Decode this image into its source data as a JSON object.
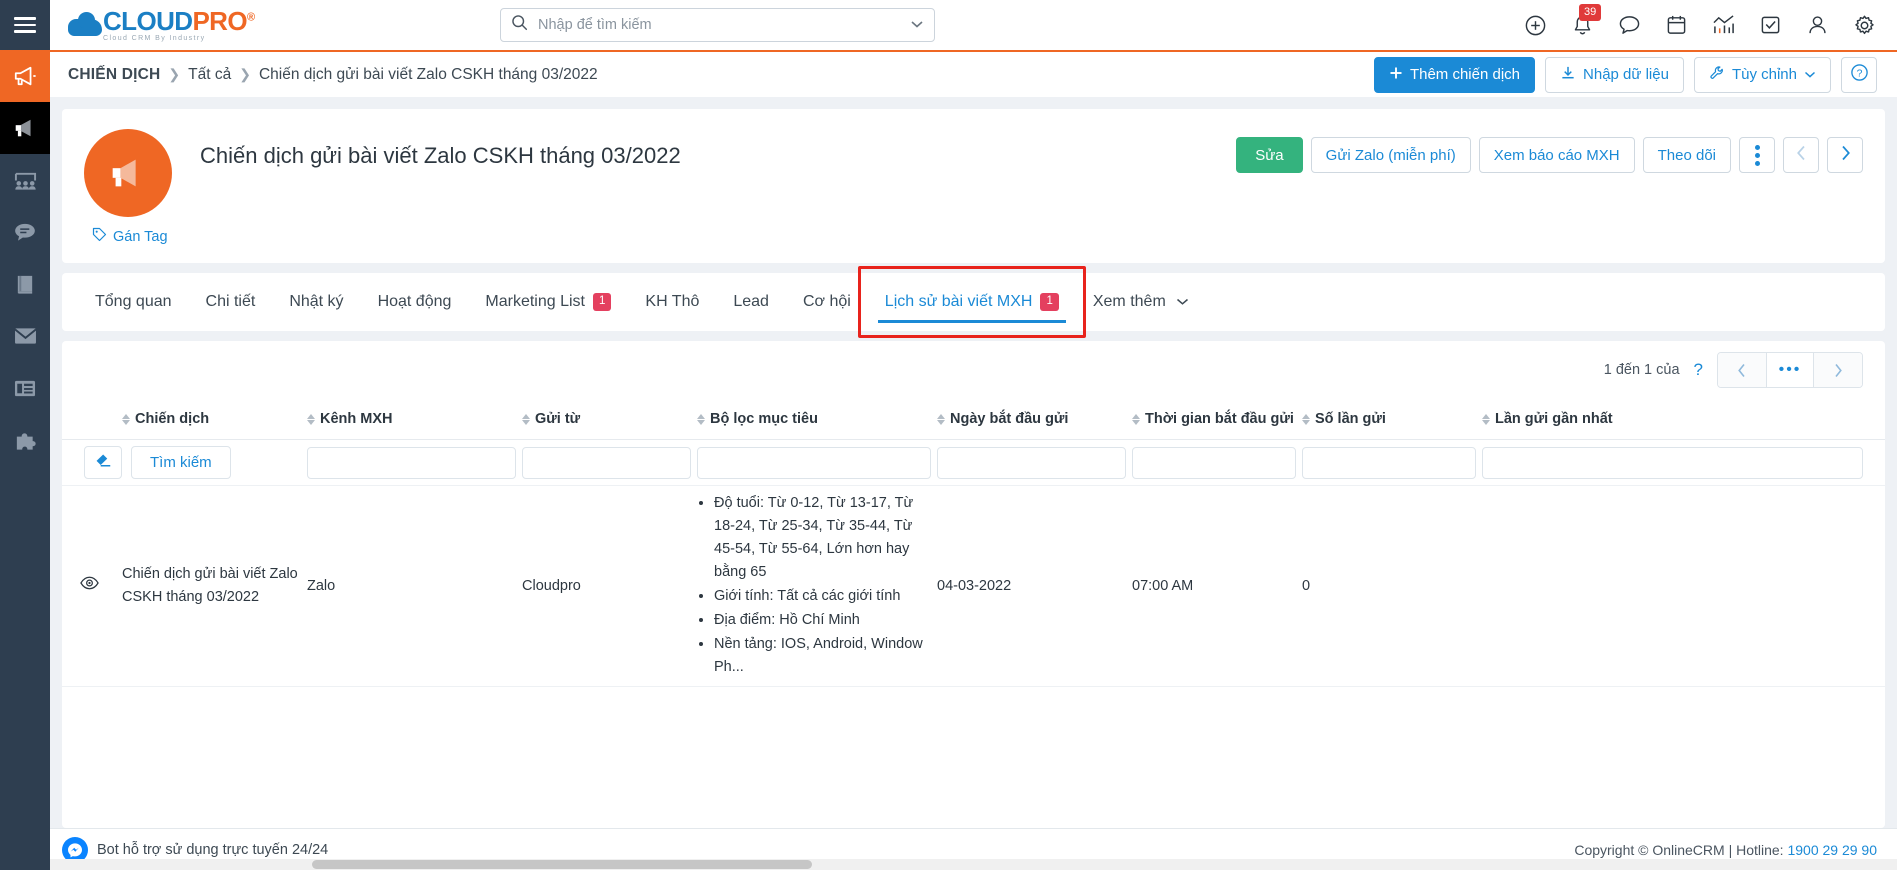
{
  "topbar": {
    "menu_icon": "hamburger-icon",
    "brand": {
      "cloud": "CLOUD",
      "pro": "PRO",
      "reg": "®",
      "tagline": "Cloud CRM By Industry"
    },
    "search": {
      "placeholder": "Nhập để tìm kiếm",
      "value": "",
      "icon": "search-icon",
      "caret": "chevron-down-icon"
    },
    "icons": [
      {
        "name": "add-circle-icon",
        "label": "Thêm"
      },
      {
        "name": "bell-icon",
        "label": "Thông báo",
        "badge": "39"
      },
      {
        "name": "chat-bubble-icon",
        "label": "Tin nhắn"
      },
      {
        "name": "calendar-icon",
        "label": "Lịch"
      },
      {
        "name": "analytics-icon",
        "label": "Báo cáo"
      },
      {
        "name": "checkbox-task-icon",
        "label": "Công việc"
      },
      {
        "name": "user-icon",
        "label": "Tài khoản"
      },
      {
        "name": "gear-icon",
        "label": "Cài đặt"
      }
    ]
  },
  "sidebar": {
    "items": [
      {
        "name": "sidebar-item-campaign",
        "icon": "megaphone-icon",
        "state": "active"
      },
      {
        "name": "sidebar-item-campaign-sub",
        "icon": "megaphone-filled-icon",
        "state": "dark"
      },
      {
        "name": "sidebar-item-customers",
        "icon": "people-group-icon",
        "state": "normal"
      },
      {
        "name": "sidebar-item-chat",
        "icon": "speech-bubble-icon",
        "state": "normal"
      },
      {
        "name": "sidebar-item-book",
        "icon": "book-icon",
        "state": "normal"
      },
      {
        "name": "sidebar-item-mail",
        "icon": "envelope-icon",
        "state": "normal"
      },
      {
        "name": "sidebar-item-news",
        "icon": "news-icon",
        "state": "normal"
      },
      {
        "name": "sidebar-item-plugin",
        "icon": "puzzle-icon",
        "state": "normal"
      }
    ]
  },
  "breadcrumb": {
    "root": "CHIẾN DỊCH",
    "sep": "❯",
    "level2": "Tất cả",
    "current": "Chiến dịch gửi bài viết Zalo CSKH tháng 03/2022"
  },
  "crumb_actions": {
    "add_campaign": "Thêm chiến dịch",
    "add_icon": "plus-icon",
    "import": "Nhập dữ liệu",
    "import_icon": "import-download-icon",
    "customize": "Tùy chỉnh",
    "customize_icon": "wrench-icon",
    "customize_caret": "chevron-down-icon",
    "help_icon": "question-circle-icon"
  },
  "record": {
    "avatar_icon": "megaphone-icon",
    "title": "Chiến dịch gửi bài viết Zalo CSKH tháng 03/2022",
    "tag_link": "Gán Tag",
    "tag_icon": "tag-icon",
    "actions": [
      {
        "name": "edit-button",
        "label": "Sửa",
        "style": "green"
      },
      {
        "name": "send-zalo-button",
        "label": "Gửi Zalo (miễn phí)",
        "style": "ghost"
      },
      {
        "name": "view-social-report-button",
        "label": "Xem báo cáo MXH",
        "style": "ghost"
      },
      {
        "name": "follow-button",
        "label": "Theo dõi",
        "style": "ghost"
      }
    ],
    "more_icon": "vertical-dots-icon",
    "prev_icon": "chevron-left-icon",
    "next_icon": "chevron-right-icon"
  },
  "tabs": [
    {
      "name": "tab-tong-quan",
      "label": "Tổng quan",
      "count": null,
      "active": false
    },
    {
      "name": "tab-chi-tiet",
      "label": "Chi tiết",
      "count": null,
      "active": false
    },
    {
      "name": "tab-nhat-ky",
      "label": "Nhật ký",
      "count": null,
      "active": false
    },
    {
      "name": "tab-hoat-dong",
      "label": "Hoạt động",
      "count": null,
      "active": false
    },
    {
      "name": "tab-marketing-list",
      "label": "Marketing List",
      "count": "1",
      "active": false
    },
    {
      "name": "tab-kh-tho",
      "label": "KH Thô",
      "count": null,
      "active": false
    },
    {
      "name": "tab-lead",
      "label": "Lead",
      "count": null,
      "active": false
    },
    {
      "name": "tab-co-hoi",
      "label": "Cơ hội",
      "count": null,
      "active": false
    },
    {
      "name": "tab-lich-su-bai-viet-mxh",
      "label": "Lịch sử bài viết MXH",
      "count": "1",
      "active": true
    },
    {
      "name": "tab-xem-them",
      "label": "Xem thêm",
      "count": null,
      "active": false,
      "caret": "chevron-down-icon"
    }
  ],
  "grid": {
    "pager": {
      "label": "1 đến 1 của",
      "unknown": "?",
      "prev_icon": "chevron-left-icon",
      "mid": "•••",
      "next_icon": "chevron-right-icon"
    },
    "search_row": {
      "clear_icon": "eraser-icon",
      "search_button": "Tìm kiếm",
      "inputs": [
        "",
        "",
        "",
        "",
        "",
        "",
        ""
      ]
    },
    "columns": [
      {
        "name": "col-view",
        "label": "",
        "sortable": false
      },
      {
        "name": "col-chien-dich",
        "label": "Chiến dịch",
        "sortable": true
      },
      {
        "name": "col-kenh-mxh",
        "label": "Kênh MXH",
        "sortable": true
      },
      {
        "name": "col-gui-tu",
        "label": "Gửi từ",
        "sortable": true
      },
      {
        "name": "col-bo-loc-muc-tieu",
        "label": "Bộ lọc mục tiêu",
        "sortable": true
      },
      {
        "name": "col-ngay-bat-dau-gui",
        "label": "Ngày bắt đầu gửi",
        "sortable": true
      },
      {
        "name": "col-thoi-gian-bat-dau-gui",
        "label": "Thời gian bắt đầu gửi",
        "sortable": true
      },
      {
        "name": "col-so-lan-gui",
        "label": "Số lần gửi",
        "sortable": true
      },
      {
        "name": "col-lan-gui-gan-nhat",
        "label": "Lần gửi gần nhất",
        "sortable": true
      }
    ],
    "rows": [
      {
        "view_icon": "eye-icon",
        "chien_dich": "Chiến dịch gửi bài viết Zalo CSKH tháng 03/2022",
        "kenh_mxh": "Zalo",
        "gui_tu": "Cloudpro",
        "bo_loc_muc_tieu": [
          "Độ tuổi: Từ 0-12, Từ 13-17, Từ 18-24, Từ 25-34, Từ 35-44, Từ 45-54, Từ 55-64, Lớn hơn hay bằng 65",
          "Giới tính: Tất cả các giới tính",
          "Địa điểm: Hồ Chí Minh",
          "Nền tảng: IOS, Android, Window Ph..."
        ],
        "ngay_bat_dau_gui": "04-03-2022",
        "thoi_gian_bat_dau_gui": "07:00 AM",
        "so_lan_gui": "0",
        "lan_gui_gan_nhat": ""
      }
    ]
  },
  "footer": {
    "bot_icon": "messenger-icon",
    "bot_text": "Bot hỗ trợ sử dụng trực tuyến 24/24",
    "copyright": "Copyright © OnlineCRM | Hotline: ",
    "hotline": "1900 29 29 90"
  },
  "colors": {
    "brand_blue": "#1b7fc4",
    "brand_orange": "#ef6724",
    "accent_blue": "#1b8ad6",
    "green": "#34b37e",
    "badge_red": "#e4405f",
    "highlight_red": "#e8231c",
    "sidebar_dark": "#2e3e50"
  }
}
